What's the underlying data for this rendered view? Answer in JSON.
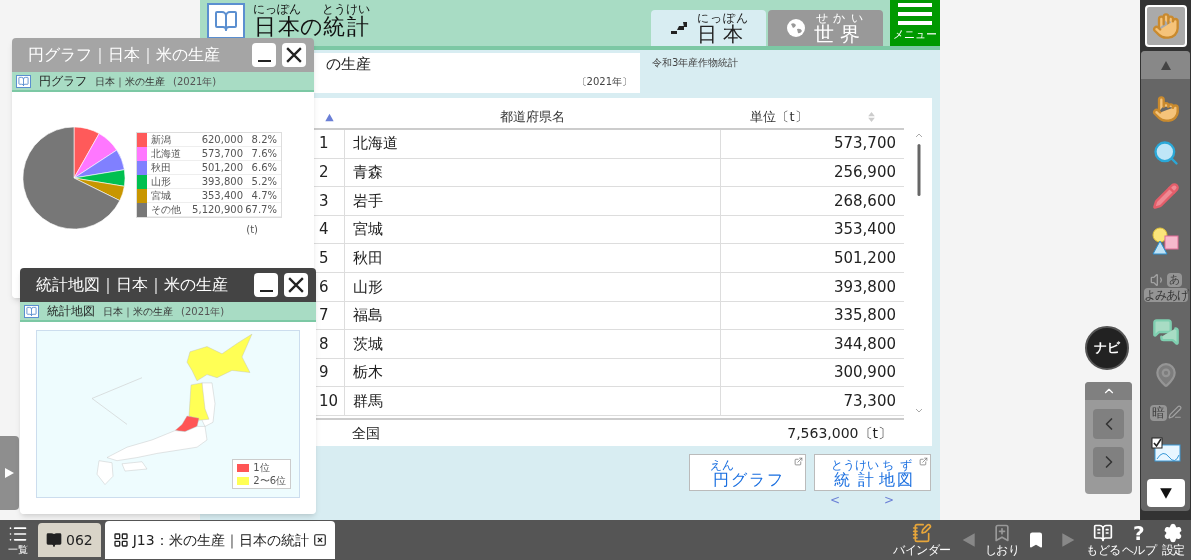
{
  "header": {
    "title": [
      {
        "base": "日本",
        "rt": "にっぽん"
      },
      {
        "base": "の"
      },
      {
        "base": "統計",
        "rt": "とうけい"
      }
    ],
    "tabs": [
      {
        "kind": "japan",
        "label": [
          {
            "base": "日本",
            "rt": "にっぽん"
          }
        ],
        "selected": true
      },
      {
        "kind": "world",
        "label": [
          {
            "base": "世界",
            "rt": "せかい"
          }
        ],
        "selected": false
      }
    ],
    "menu_button": {
      "label": "メニュー"
    }
  },
  "topic": {
    "title": "の生産",
    "year": "〔2021年〕",
    "source": "令和3年産作物統計"
  },
  "table": {
    "columns": [
      "都道府県名",
      "単位〔t〕"
    ],
    "rows": [
      {
        "rank": "1",
        "name": "北海道",
        "value": "573,700"
      },
      {
        "rank": "2",
        "name": "青森",
        "value": "256,900"
      },
      {
        "rank": "3",
        "name": "岩手",
        "value": "268,600"
      },
      {
        "rank": "4",
        "name": "宮城",
        "value": "353,400"
      },
      {
        "rank": "5",
        "name": "秋田",
        "value": "501,200"
      },
      {
        "rank": "6",
        "name": "山形",
        "value": "393,800"
      },
      {
        "rank": "7",
        "name": "福島",
        "value": "335,800"
      },
      {
        "rank": "8",
        "name": "茨城",
        "value": "344,800"
      },
      {
        "rank": "9",
        "name": "栃木",
        "value": "300,900"
      },
      {
        "rank": "10",
        "name": "群馬",
        "value": "73,300"
      }
    ],
    "total": {
      "label": "全国",
      "value": "7,563,000〔t〕"
    }
  },
  "buttons": [
    {
      "label": [
        {
          "base": "円",
          "rt": "えん"
        },
        {
          "base": "グラフ"
        }
      ]
    },
    {
      "label": [
        {
          "base": "統",
          "rt": "とう"
        },
        {
          "base": "計",
          "rt": "けい"
        },
        {
          "base": "地",
          "rt": "ち"
        },
        {
          "base": "図",
          "rt": "ず"
        }
      ]
    }
  ],
  "pager": {
    "prev": "<",
    "next": ">"
  },
  "windows": [
    {
      "kind": "pie",
      "active": false,
      "title": "円グラフ｜日本｜米の生産",
      "strip": {
        "name": "円グラフ",
        "subject": "日本｜米の生産",
        "year": "(2021年)"
      },
      "chart_data": {
        "type": "pie",
        "categories": [
          "新潟",
          "北海道",
          "秋田",
          "山形",
          "宮城",
          "その他"
        ],
        "values": [
          8.2,
          7.6,
          6.6,
          5.2,
          4.7,
          67.7
        ]
      },
      "legend": [
        {
          "amount": "620,000",
          "share": "8.2%",
          "color": "#ff5a5a"
        },
        {
          "amount": "573,700",
          "share": "7.6%",
          "color": "#ff77ff"
        },
        {
          "amount": "501,200",
          "share": "6.6%",
          "color": "#8080ff"
        },
        {
          "amount": "393,800",
          "share": "5.2%",
          "color": "#00c050"
        },
        {
          "amount": "353,400",
          "share": "4.7%",
          "color": "#c89600"
        },
        {
          "amount": "5,120,900",
          "share": "67.7%",
          "color": "#777777"
        }
      ],
      "unit": "(t)"
    },
    {
      "kind": "map",
      "active": true,
      "title": "統計地図｜日本｜米の生産",
      "strip": {
        "name": "統計地図",
        "subject": "日本｜米の生産",
        "year": "(2021年)"
      },
      "legend": [
        {
          "label": "1位",
          "color": "#ff5555"
        },
        {
          "label": "2〜6位",
          "color": "#ffff55"
        }
      ]
    }
  ],
  "navi": {
    "label": "ナビ"
  },
  "hand_tool": {
    "selected": true
  },
  "tools": [
    {
      "kind": "pointer",
      "disabled": false
    },
    {
      "kind": "zoom",
      "disabled": false
    },
    {
      "kind": "pen",
      "disabled": false
    },
    {
      "kind": "shapes",
      "disabled": false
    },
    {
      "kind": "read_aloud",
      "glyph": "あ",
      "label": "よみあげ",
      "disabled": true
    },
    {
      "kind": "comment",
      "disabled": false
    },
    {
      "kind": "pin",
      "disabled": true
    },
    {
      "kind": "mask",
      "glyph": "暗",
      "disabled": true
    },
    {
      "kind": "card",
      "disabled": false
    }
  ],
  "bottom_bar": {
    "list_label": "一覧",
    "page": "062",
    "doc_tab": "J13：米の生産｜日本の統計",
    "actions": [
      {
        "kind": "binder",
        "label": "バインダー"
      },
      {
        "kind": "prev"
      },
      {
        "kind": "add_bookmark",
        "label": "しおり"
      },
      {
        "kind": "bookmark"
      },
      {
        "kind": "next"
      },
      {
        "kind": "back",
        "label": "もどる"
      },
      {
        "kind": "help",
        "glyph": "?",
        "label": "ヘルプ"
      },
      {
        "kind": "settings",
        "label": "設定"
      }
    ]
  }
}
